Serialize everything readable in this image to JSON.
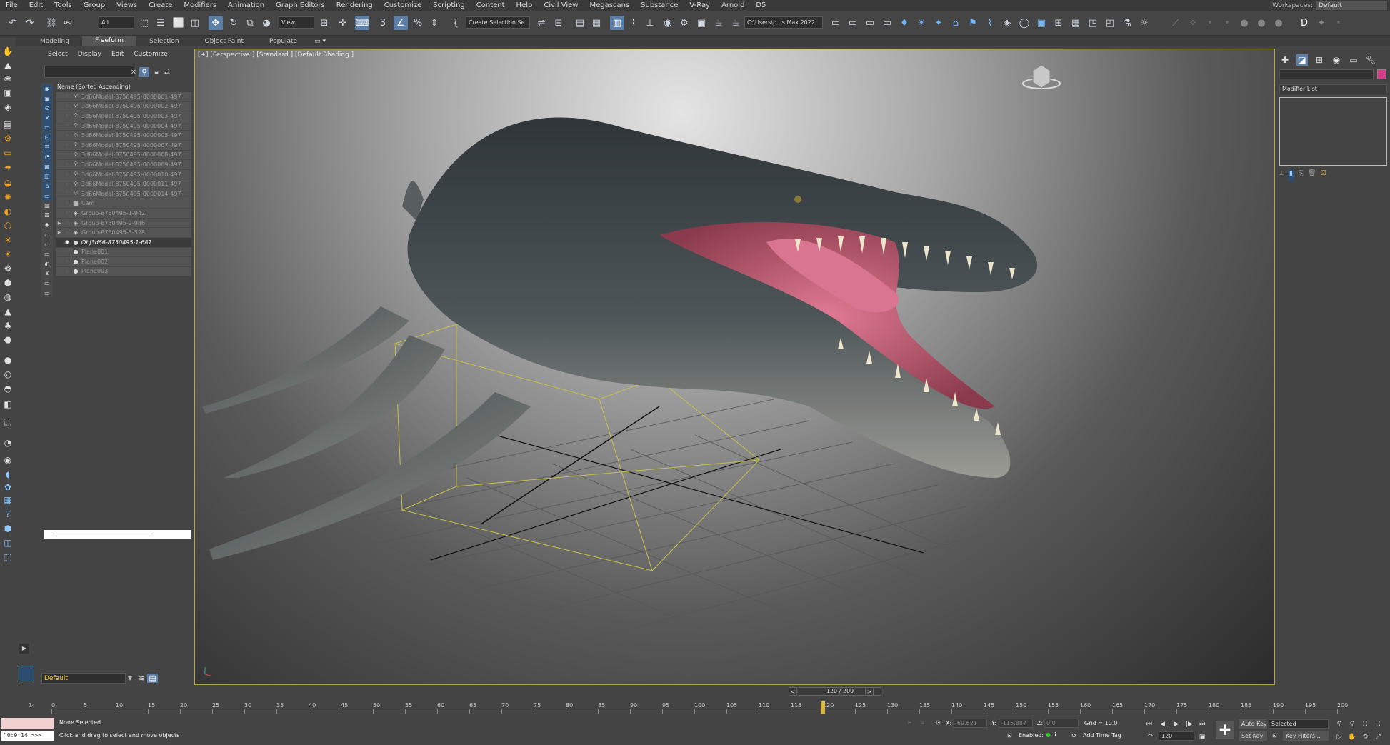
{
  "menus": [
    "File",
    "Edit",
    "Tools",
    "Group",
    "Views",
    "Create",
    "Modifiers",
    "Animation",
    "Graph Editors",
    "Rendering",
    "Customize",
    "Scripting",
    "Content",
    "Help",
    "Civil View",
    "Megascans",
    "Substance",
    "V-Ray",
    "Arnold",
    "D5"
  ],
  "workspaces": {
    "label": "Workspaces:",
    "value": "Default"
  },
  "toolbar": {
    "filter": "All",
    "ref_coord": "View",
    "selection_set": "Create Selection Se",
    "project_path": "C:\\Users\\p...s Max 2022"
  },
  "ribbon_tabs": [
    "Modeling",
    "Freeform",
    "Selection",
    "Object Paint",
    "Populate"
  ],
  "ribbon_active": "Freeform",
  "scene_menu": [
    "Select",
    "Display",
    "Edit",
    "Customize"
  ],
  "scene_header": "Name (Sorted Ascending)",
  "scene_items": [
    {
      "name": "3d66Model-8750495-0000001-497",
      "icon": "light",
      "exp": ""
    },
    {
      "name": "3d66Model-8750495-0000002-497",
      "icon": "light",
      "exp": ""
    },
    {
      "name": "3d66Model-8750495-0000003-497",
      "icon": "light",
      "exp": ""
    },
    {
      "name": "3d66Model-8750495-0000004-497",
      "icon": "light",
      "exp": ""
    },
    {
      "name": "3d66Model-8750495-0000005-497",
      "icon": "light",
      "exp": ""
    },
    {
      "name": "3d66Model-8750495-0000007-497",
      "icon": "light",
      "exp": ""
    },
    {
      "name": "3d66Model-8750495-0000008-497",
      "icon": "light",
      "exp": ""
    },
    {
      "name": "3d66Model-8750495-0000009-497",
      "icon": "light",
      "exp": ""
    },
    {
      "name": "3d66Model-8750495-0000010-497",
      "icon": "light",
      "exp": ""
    },
    {
      "name": "3d66Model-8750495-0000011-497",
      "icon": "light",
      "exp": ""
    },
    {
      "name": "3d66Model-8750495-0000014-497",
      "icon": "light",
      "exp": ""
    },
    {
      "name": "Cam",
      "icon": "camera",
      "exp": ""
    },
    {
      "name": "Group-8750495-1-942",
      "icon": "group",
      "exp": ""
    },
    {
      "name": "Group-8750495-2-986",
      "icon": "group",
      "exp": "▶"
    },
    {
      "name": "Group-8750495-3-328",
      "icon": "group",
      "exp": "▶"
    },
    {
      "name": "Obj3d66-8750495-1-681",
      "icon": "object",
      "exp": "",
      "selected": true
    },
    {
      "name": "Plane001",
      "icon": "object",
      "exp": ""
    },
    {
      "name": "Plane002",
      "icon": "object",
      "exp": ""
    },
    {
      "name": "Plane003",
      "icon": "object",
      "exp": ""
    }
  ],
  "layer": "Default",
  "viewport": {
    "label": "[+] [Perspective ] [Standard ] [Default Shading ]"
  },
  "command_panel": {
    "modifier_list": "Modifier List",
    "swatch_color": "#d43c8a"
  },
  "time_slider": {
    "value": "120 / 200"
  },
  "timeline_ticks": [
    "0",
    "5",
    "10",
    "15",
    "20",
    "25",
    "30",
    "35",
    "40",
    "45",
    "50",
    "55",
    "60",
    "65",
    "70",
    "75",
    "80",
    "85",
    "90",
    "95",
    "100",
    "105",
    "110",
    "115",
    "120",
    "125",
    "130",
    "135",
    "140",
    "145",
    "150",
    "155",
    "160",
    "165",
    "170",
    "175",
    "180",
    "185",
    "190",
    "195",
    "200"
  ],
  "status": {
    "maxscript_text": "\"0:9:14 >>>",
    "selection": "None Selected",
    "prompt": "Click and drag to select and move objects",
    "x_label": "X:",
    "x_value": "-69.621",
    "y_label": "Y:",
    "y_value": "-115.887",
    "z_label": "Z:",
    "z_value": "0.0",
    "grid": "Grid = 10.0",
    "enabled": "Enabled:",
    "add_time_tag": "Add Time Tag",
    "auto_key": "Auto Key",
    "set_key": "Set Key",
    "key_mode": "Selected",
    "frame": "120",
    "key_filters": "Key Filters..."
  }
}
